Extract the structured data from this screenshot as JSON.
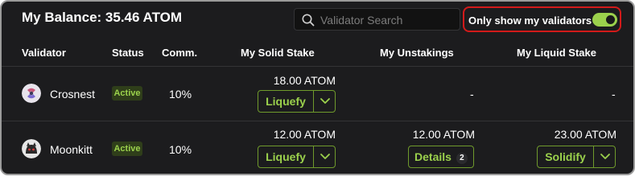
{
  "header": {
    "balance": "My Balance: 35.46 ATOM",
    "search_placeholder": "Validator Search",
    "toggle_label": "Only show my validators",
    "toggle_on": true
  },
  "columns": {
    "validator": "Validator",
    "status": "Status",
    "comm": "Comm.",
    "solid": "My Solid Stake",
    "unstakings": "My Unstakings",
    "liquid": "My Liquid Stake"
  },
  "rows": [
    {
      "name": "Crosnest",
      "status": "Active",
      "commission": "10%",
      "solid_stake": "18.00 ATOM",
      "solid_action": "Liquefy",
      "unstakings": "-",
      "liquid_stake": "-"
    },
    {
      "name": "Moonkitt",
      "status": "Active",
      "commission": "10%",
      "solid_stake": "12.00 ATOM",
      "solid_action": "Liquefy",
      "unstakings": "12.00 ATOM",
      "unstakings_action": "Details",
      "unstakings_count": "2",
      "liquid_stake": "23.00 ATOM",
      "liquid_action": "Solidify"
    }
  ],
  "icons": {
    "search": "search-icon",
    "chevron": "chevron-down-icon",
    "avatar_1": "crosnest-logo",
    "avatar_2": "moonkitt-logo"
  },
  "colors": {
    "background": "#1c1c1e",
    "accent": "#9bd14c",
    "badge_bg": "#2f3e1a",
    "highlight_border": "#d21a1a"
  }
}
